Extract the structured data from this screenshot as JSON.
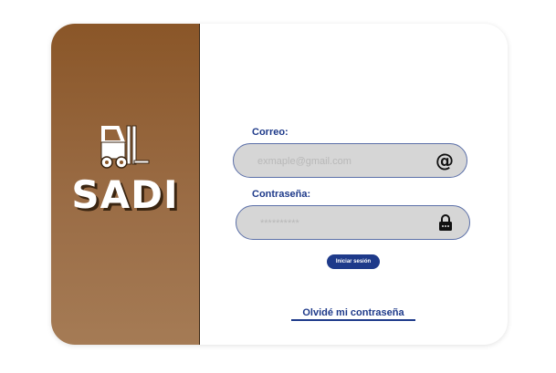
{
  "brand": {
    "name": "SADI",
    "logo_icon": "forklift-icon",
    "panel_color": "#8a5628"
  },
  "login_form": {
    "email_label": "Correo:",
    "email_placeholder": "exmaple@gmail.com",
    "email_icon": "at-sign-icon",
    "password_label": "Contraseña:",
    "password_placeholder": "**********",
    "password_icon": "lock-icon",
    "submit_label": "Iniciar sesión",
    "forgot_label": "Olvidé mi contraseña",
    "accent_color": "#1e3a8a"
  }
}
